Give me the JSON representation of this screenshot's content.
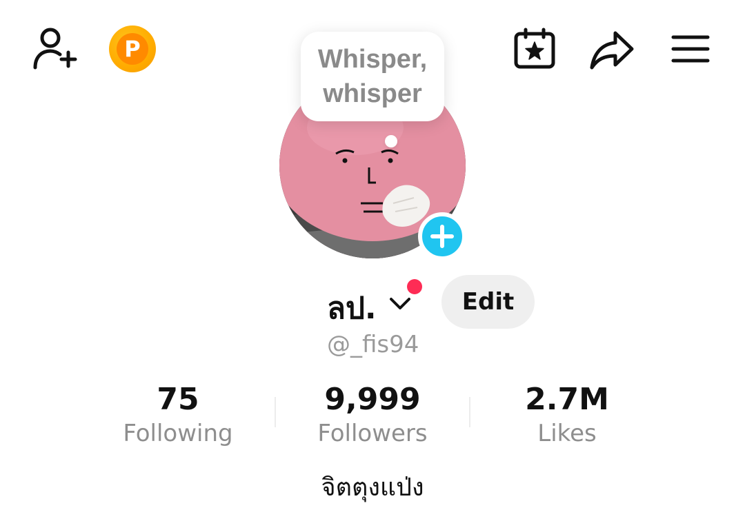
{
  "header": {
    "add_friend_icon": "person-plus-icon",
    "coin_icon": "p-coin-icon",
    "coin_letter": "P",
    "calendar_icon": "calendar-star-icon",
    "share_icon": "share-arrow-icon",
    "menu_icon": "hamburger-menu-icon"
  },
  "profile": {
    "status_bubble": "Whisper,\nwhisper",
    "display_name": "ลป.",
    "username": "@_fis94",
    "edit_label": "Edit",
    "bio": "จิตตุงแป่ง",
    "notification_color": "#fe2c55",
    "add_avatar_color": "#20c5f0"
  },
  "stats": [
    {
      "value": "75",
      "label": "Following"
    },
    {
      "value": "9,999",
      "label": "Followers"
    },
    {
      "value": "2.7M",
      "label": "Likes"
    }
  ]
}
